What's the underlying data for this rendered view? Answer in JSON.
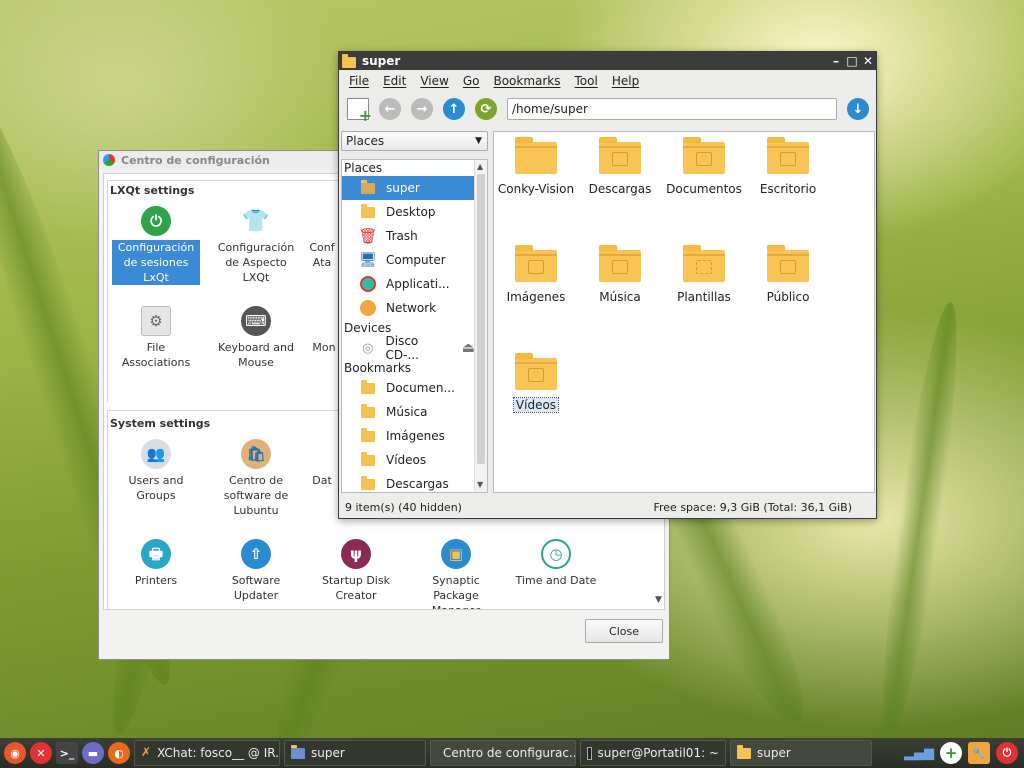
{
  "config_window": {
    "title": "Centro de configuración",
    "lxqt_group": "LXQt settings",
    "system_group": "System settings",
    "lxqt_items": [
      {
        "label": "Configuración de sesiones LxQt",
        "icon": "power-icon",
        "color": "#2ea34a"
      },
      {
        "label": "Configuración de Aspecto LXQt",
        "icon": "shirt-icon",
        "color": "#e8506e"
      },
      {
        "label": "Conf Ata",
        "icon": "keyboard-shortcut-icon",
        "color": "#888888"
      },
      {
        "label": "File Associations",
        "icon": "gear-icon",
        "color": "#9a9a9a"
      },
      {
        "label": "Keyboard and Mouse",
        "icon": "keyboard-icon",
        "color": "#555555"
      },
      {
        "label": "Mon",
        "icon": "monitor-icon",
        "color": "#888888"
      }
    ],
    "system_items": [
      {
        "label": "Users and Groups",
        "icon": "users-icon",
        "color": "#3f6d9e"
      },
      {
        "label": "Centro de software de Lubuntu",
        "icon": "software-bag-icon",
        "color": "#c9833a"
      },
      {
        "label": "Dat",
        "icon": "date-icon",
        "color": "#888888"
      },
      {
        "label": "Printers",
        "icon": "printer-icon",
        "color": "#2aa7c7"
      },
      {
        "label": "Software Updater",
        "icon": "updater-icon",
        "color": "#2a8bd1"
      },
      {
        "label": "Startup Disk Creator",
        "icon": "usb-icon",
        "color": "#8b2a55"
      },
      {
        "label": "Synaptic Package Manager",
        "icon": "package-icon",
        "color": "#2a8bd1"
      },
      {
        "label": "Time and Date",
        "icon": "clock-icon",
        "color": "#2aa58a"
      }
    ],
    "close_label": "Close"
  },
  "file_manager": {
    "title": "super",
    "menu": [
      "File",
      "Edit",
      "View",
      "Go",
      "Bookmarks",
      "Tool",
      "Help"
    ],
    "path": "/home/super",
    "side_select": "Places",
    "side": {
      "places_header": "Places",
      "places": [
        {
          "label": "super",
          "icon": "home-folder-icon",
          "selected": true
        },
        {
          "label": "Desktop",
          "icon": "desktop-folder-icon"
        },
        {
          "label": "Trash",
          "icon": "trash-icon"
        },
        {
          "label": "Computer",
          "icon": "computer-icon"
        },
        {
          "label": "Applicati...",
          "icon": "applications-icon"
        },
        {
          "label": "Network",
          "icon": "network-icon"
        }
      ],
      "devices_header": "Devices",
      "devices": [
        {
          "label": "Disco CD-...",
          "icon": "cd-icon"
        }
      ],
      "bookmarks_header": "Bookmarks",
      "bookmarks": [
        {
          "label": "Documen..."
        },
        {
          "label": "Música"
        },
        {
          "label": "Imágenes"
        },
        {
          "label": "Vídeos"
        },
        {
          "label": "Descargas"
        }
      ]
    },
    "files": [
      {
        "label": "Conky-Vision",
        "emblem": ""
      },
      {
        "label": "Descargas",
        "emblem": "download"
      },
      {
        "label": "Documentos",
        "emblem": "document"
      },
      {
        "label": "Escritorio",
        "emblem": "desktop"
      },
      {
        "label": "Imágenes",
        "emblem": "image"
      },
      {
        "label": "Música",
        "emblem": "music"
      },
      {
        "label": "Plantillas",
        "emblem": "template"
      },
      {
        "label": "Público",
        "emblem": "users"
      },
      {
        "label": "Vídeos",
        "emblem": "video"
      }
    ],
    "status_left": "9 item(s) (40 hidden)",
    "status_right": "Free space: 9,3 GiB (Total: 36,1 GiB)"
  },
  "taskbar": {
    "tasks": [
      {
        "label": "XChat: fosco__ @ IR...",
        "icon": "xchat-icon"
      },
      {
        "label": "super",
        "icon": "folder-icon"
      },
      {
        "label": "Centro de configurac...",
        "icon": "config-center-icon"
      },
      {
        "label": "super@Portatil01: ~",
        "icon": "terminal-icon"
      },
      {
        "label": "super",
        "icon": "folder-icon"
      }
    ]
  }
}
